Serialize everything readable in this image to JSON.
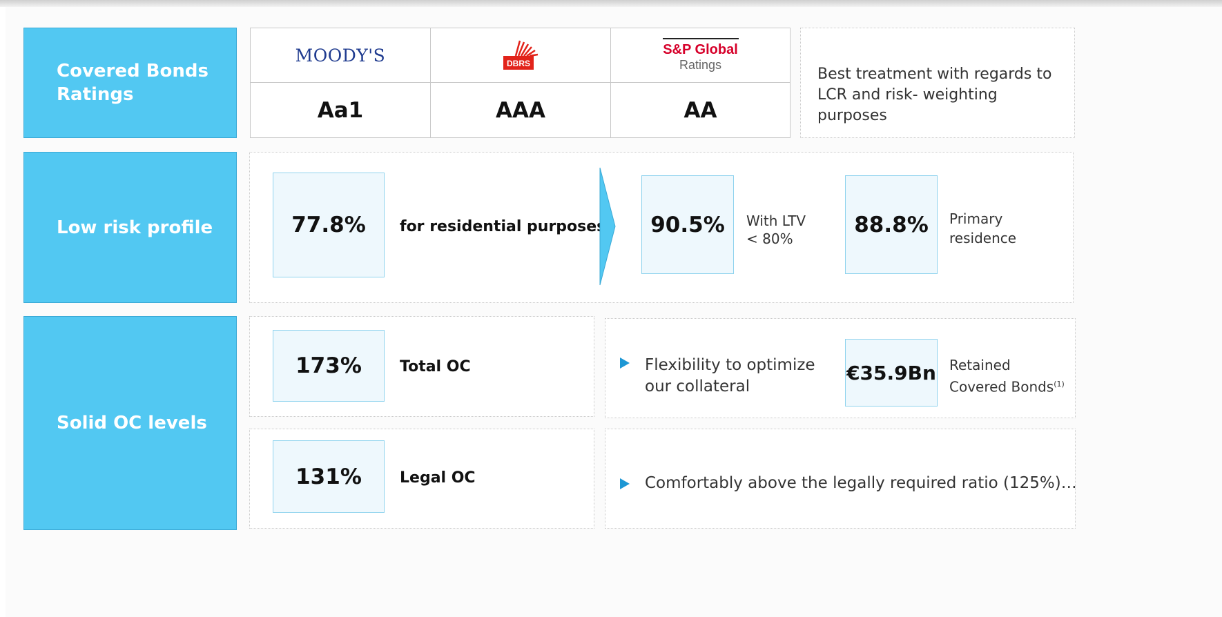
{
  "ratings": {
    "label": "Covered Bonds Ratings",
    "agencies": [
      {
        "name": "Moody's",
        "logo_text": "MOODY'S",
        "rating": "Aa1"
      },
      {
        "name": "DBRS",
        "logo_text": "DBRS",
        "rating": "AAA"
      },
      {
        "name": "S&P Global Ratings",
        "logo_text_top": "S&P Global",
        "logo_text_bottom": "Ratings",
        "rating": "AA"
      }
    ],
    "note": "Best treatment with regards to LCR and risk- weighting purposes"
  },
  "risk": {
    "label": "Low risk profile",
    "main_value": "77.8%",
    "main_text": "for residential purposes",
    "items": [
      {
        "value": "90.5%",
        "text_line1": "With LTV",
        "text_line2": "< 80%"
      },
      {
        "value": "88.8%",
        "text_line1": "Primary",
        "text_line2": "residence"
      }
    ]
  },
  "oc": {
    "label": "Solid OC levels",
    "total": {
      "value": "173%",
      "text": "Total OC"
    },
    "legal": {
      "value": "131%",
      "text": "Legal OC"
    },
    "flex_line1": "Flexibility to optimize",
    "flex_line2": "our collateral",
    "retained_value": "€35.9Bn",
    "retained_line1": "Retained",
    "retained_line2": "Covered Bonds",
    "retained_footnote": "(1)",
    "comfort_text": "Comfortably above the legally required ratio (125%)…"
  },
  "colors": {
    "accent": "#52c8f2",
    "box_fill": "#eef8fd",
    "bullet": "#1d97d4",
    "sp_red": "#d6002a",
    "moodys_blue": "#1f3b8f",
    "dbrs_red": "#e2231a"
  }
}
